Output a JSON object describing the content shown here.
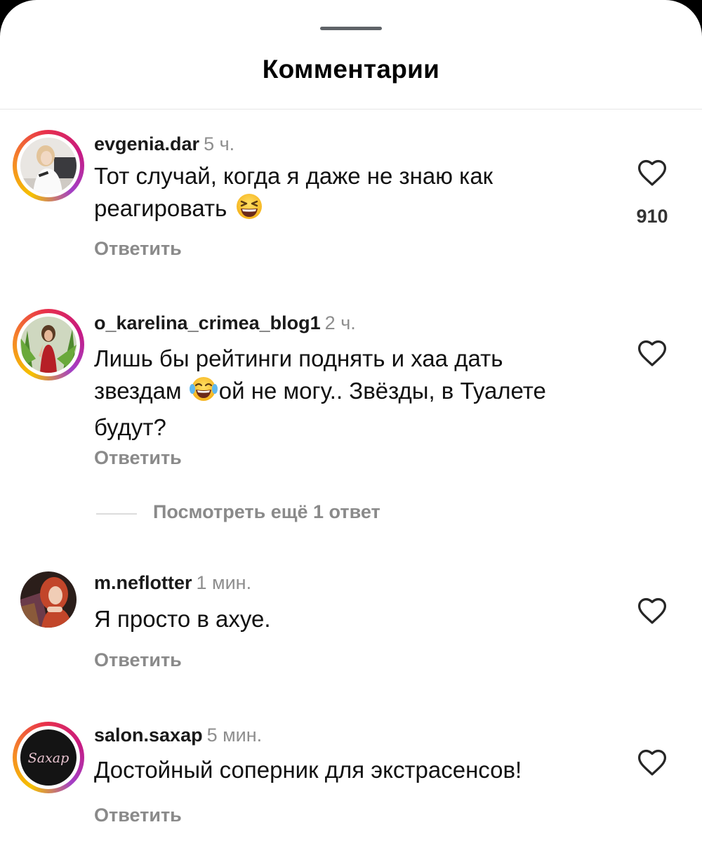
{
  "sheet": {
    "title": "Комментарии"
  },
  "colors": {
    "ring_start": "#f5c100",
    "ring_mid": "#e8314b",
    "ring_end": "#a33fc6",
    "muted": "#8e8e8e"
  },
  "comments": [
    {
      "username": "evgenia.dar",
      "time": "5 ч.",
      "text_before": "Тот случай, когда я даже не знаю как реагировать",
      "emoji": "grinning-squinting-face",
      "text_after": "",
      "likes": "910",
      "reply_label": "Ответить",
      "story_ring": true
    },
    {
      "username": "o_karelina_crimea_blog1",
      "time": "2 ч.",
      "text_before": "Лишь бы рейтинги поднять и хаа дать звездам",
      "emoji": "face-with-tears-of-joy",
      "text_after": "ой не могу.. Звёзды, в Туалете будут?",
      "likes": "",
      "reply_label": "Ответить",
      "story_ring": true
    },
    {
      "username": "m.neflotter",
      "time": "1 мин.",
      "text_before": "Я просто в ахуе.",
      "emoji": "",
      "text_after": "",
      "likes": "",
      "reply_label": "Ответить",
      "story_ring": false
    },
    {
      "username": "salon.saxap",
      "time": "5 мин.",
      "text_before": "Достойный соперник для экстрасенсов!",
      "emoji": "",
      "text_after": "",
      "likes": "",
      "reply_label": "Ответить",
      "story_ring": true,
      "avatar_logo_text": "Saxap"
    }
  ],
  "view_more_replies": "Посмотреть ещё 1 ответ",
  "icons": {
    "like": "heart-outline-icon"
  }
}
